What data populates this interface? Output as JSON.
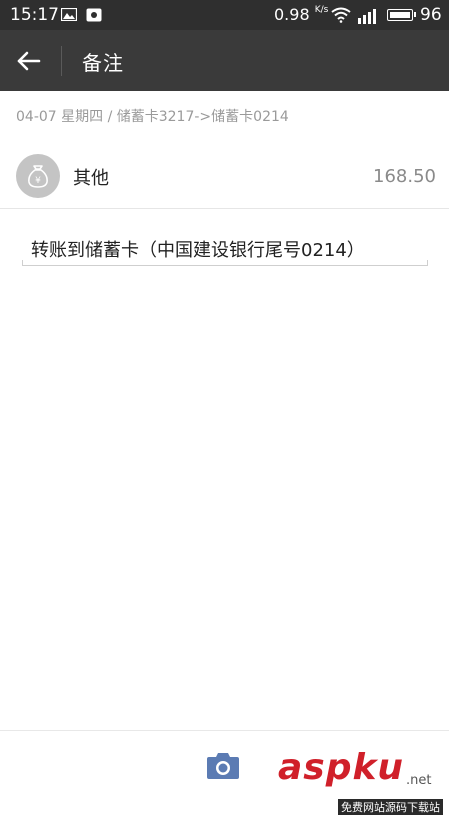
{
  "status_bar": {
    "time": "15:17",
    "net_speed": "0.98",
    "net_speed_unit": "K/s",
    "battery": "96"
  },
  "top_bar": {
    "title": "备注"
  },
  "record": {
    "breadcrumb": "04-07 星期四 / 储蓄卡3217->储蓄卡0214",
    "category_name": "其他",
    "category_icon_symbol": "¥",
    "amount": "168.50"
  },
  "memo": {
    "text": "转账到储蓄卡（中国建设银行尾号0214）"
  },
  "watermark": {
    "brand": "aspku",
    "net": ".net",
    "sub": "免费网站源码下载站"
  },
  "colors": {
    "status_bar_bg": "#2f2f2f",
    "top_bar_bg": "#3a3a3a",
    "camera_icon": "#5b7bb3",
    "watermark_red": "#d0202a"
  },
  "icons": {
    "back": "arrow-left-icon",
    "camera": "camera-icon",
    "category": "money-bag-icon"
  }
}
